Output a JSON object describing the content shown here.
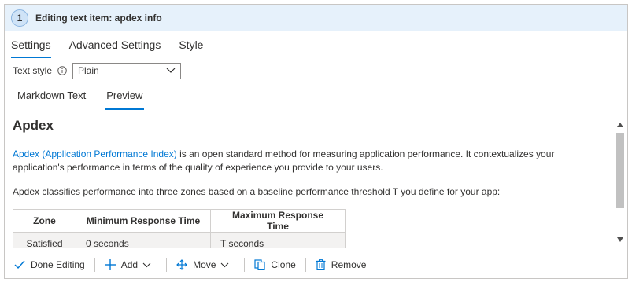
{
  "header": {
    "step": "1",
    "title": "Editing text item: apdex info"
  },
  "tabs": [
    {
      "label": "Settings",
      "active": true
    },
    {
      "label": "Advanced Settings",
      "active": false
    },
    {
      "label": "Style",
      "active": false
    }
  ],
  "text_style": {
    "label": "Text style",
    "value": "Plain"
  },
  "subtabs": [
    {
      "label": "Markdown Text",
      "active": false
    },
    {
      "label": "Preview",
      "active": true
    }
  ],
  "preview": {
    "heading": "Apdex",
    "para1_link": "Apdex (Application Performance Index)",
    "para1_rest": " is an open standard method for measuring application performance. It contextualizes your application's performance in terms of the quality of experience you provide to your users.",
    "para2": "Apdex classifies performance into three zones based on a baseline performance threshold T you define for your app:",
    "table": {
      "headers": [
        "Zone",
        "Minimum Response Time",
        "Maximum Response Time"
      ],
      "rows": [
        [
          "Satisfied",
          "0 seconds",
          "T seconds"
        ]
      ]
    }
  },
  "toolbar": {
    "done": "Done Editing",
    "add": "Add",
    "move": "Move",
    "clone": "Clone",
    "remove": "Remove"
  },
  "colors": {
    "accent": "#0078d4",
    "header_bg": "#e6f1fb"
  }
}
